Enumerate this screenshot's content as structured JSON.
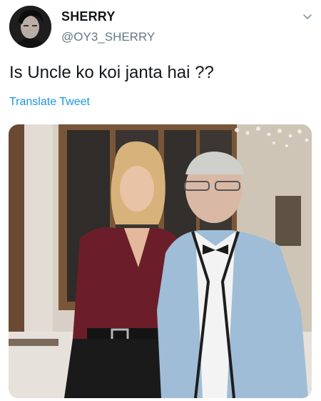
{
  "user": {
    "display_name": "SHERRY",
    "handle": "@OY3_SHERRY",
    "avatar_icon": "profile-photo-icon"
  },
  "tweet": {
    "text": "Is Uncle ko koi janta hai ??",
    "translate_label": "Translate Tweet"
  },
  "menu": {
    "icon": "chevron-down-icon"
  },
  "colors": {
    "text_primary": "#14171a",
    "text_secondary": "#657786",
    "link": "#1b95e0"
  }
}
